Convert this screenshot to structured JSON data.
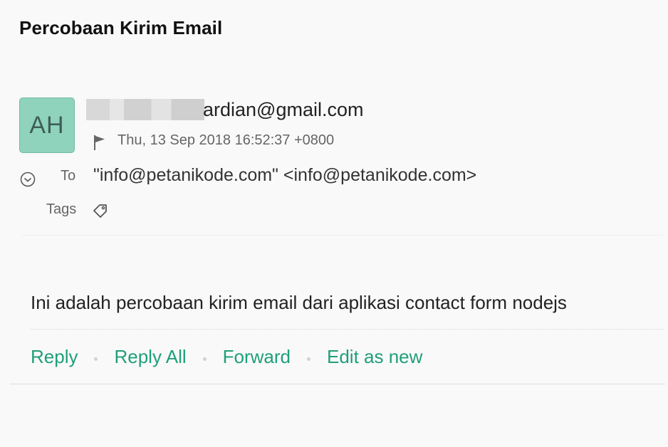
{
  "message": {
    "subject": "Percobaan Kirim Email",
    "sender": {
      "initials": "AH",
      "address_visible": "ardian@gmail.com",
      "avatar_color": "#8fd3bd"
    },
    "date": "Thu, 13 Sep 2018 16:52:37 +0800",
    "to": {
      "label": "To",
      "value": "\"info@petanikode.com\" <info@petanikode.com>"
    },
    "tags": {
      "label": "Tags"
    },
    "body": "Ini adalah percobaan kirim email dari aplikasi contact form nodejs"
  },
  "actions": {
    "reply": "Reply",
    "reply_all": "Reply All",
    "forward": "Forward",
    "edit_as_new": "Edit as new"
  },
  "icons": {
    "flag": "flag-icon",
    "toggle": "chevron-down-circle-icon",
    "tag": "tag-icon"
  },
  "colors": {
    "action_link": "#1f9f7a",
    "avatar_bg": "#8fd3bd"
  }
}
